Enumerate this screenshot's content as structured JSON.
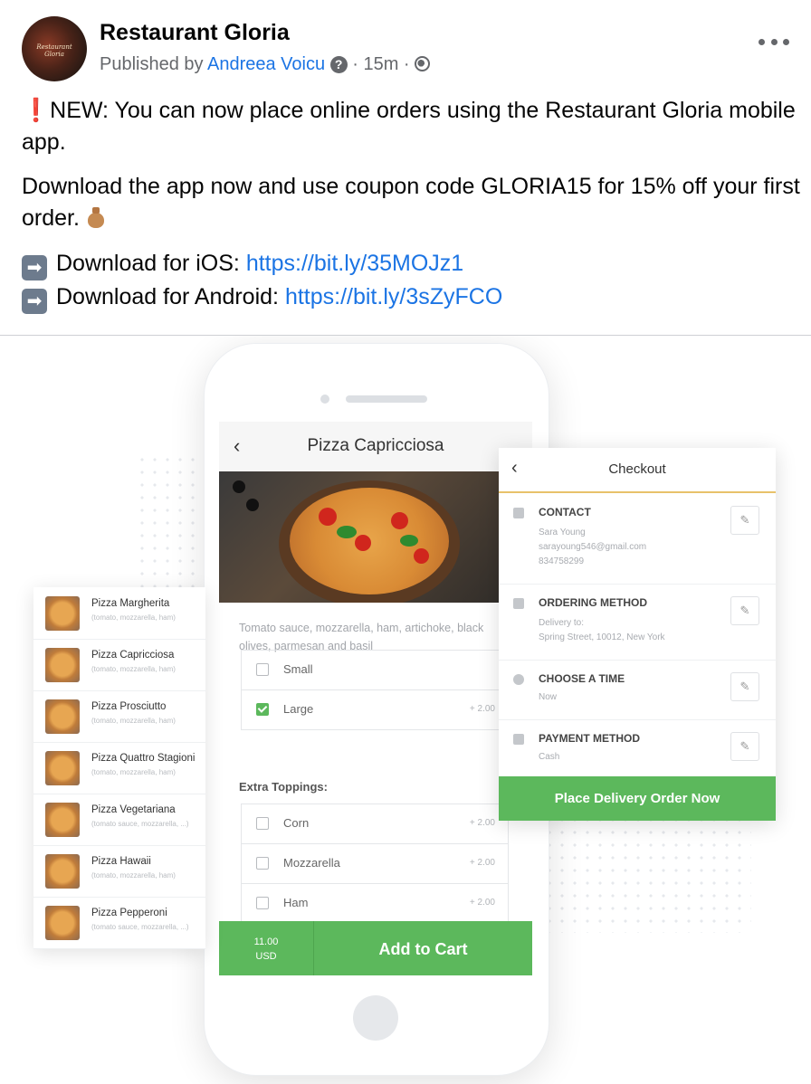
{
  "post": {
    "page_name": "Restaurant Gloria",
    "avatar_text": "Restaurant Gloria",
    "published_by": "Published by",
    "author": "Andreea Voicu",
    "time": "15m",
    "sep": "·",
    "para1": "NEW: You can now place online orders using the Restaurant Gloria mobile app.",
    "para1_mark": "❗",
    "para2": "Download the app now and use coupon code GLORIA15 for 15% off your first order.",
    "ios_label": "Download for iOS:",
    "ios_link": "https://bit.ly/35MOJz1",
    "android_label": "Download for Android:",
    "android_link": "https://bit.ly/3sZyFCO",
    "arrow_glyph": "➡"
  },
  "app": {
    "product_title": "Pizza Capricciosa",
    "description": "Tomato sauce, mozzarella, ham, artichoke, black olives, parmesan and basil",
    "sizes": [
      {
        "label": "Small",
        "price": "",
        "checked": false
      },
      {
        "label": "Large",
        "price": "+ 2.00",
        "checked": true
      }
    ],
    "extra_title": "Extra Toppings:",
    "toppings": [
      {
        "label": "Corn",
        "price": "+ 2.00"
      },
      {
        "label": "Mozzarella",
        "price": "+ 2.00"
      },
      {
        "label": "Ham",
        "price": "+ 2.00"
      }
    ],
    "price": "11.00",
    "currency": "USD",
    "add_to_cart": "Add to Cart"
  },
  "menu": {
    "items": [
      {
        "name": "Pizza Margherita",
        "sub": "(tomato, mozzarella, ham)"
      },
      {
        "name": "Pizza Capricciosa",
        "sub": "(tomato, mozzarella, ham)"
      },
      {
        "name": "Pizza Prosciutto",
        "sub": "(tomato, mozzarella, ham)"
      },
      {
        "name": "Pizza Quattro Stagioni",
        "sub": "(tomato, mozzarella, ham)"
      },
      {
        "name": "Pizza Vegetariana",
        "sub": "(tomato sauce, mozzarella, ...)"
      },
      {
        "name": "Pizza Hawaii",
        "sub": "(tomato, mozzarella, ham)"
      },
      {
        "name": "Pizza Pepperoni",
        "sub": "(tomato sauce, mozzarella, ...)"
      }
    ]
  },
  "checkout": {
    "title": "Checkout",
    "contact_label": "CONTACT",
    "contact_name": "Sara Young",
    "contact_email": "sarayoung546@gmail.com",
    "contact_phone": "834758299",
    "method_label": "ORDERING METHOD",
    "method_line1": "Delivery to:",
    "method_line2": "Spring Street, 10012, New York",
    "time_label": "CHOOSE A TIME",
    "time_value": "Now",
    "payment_label": "PAYMENT METHOD",
    "payment_value": "Cash",
    "button": "Place Delivery Order Now"
  },
  "colors": {
    "link": "#1b74e4",
    "green": "#5cb85c",
    "accent_line": "#e8c26a"
  }
}
